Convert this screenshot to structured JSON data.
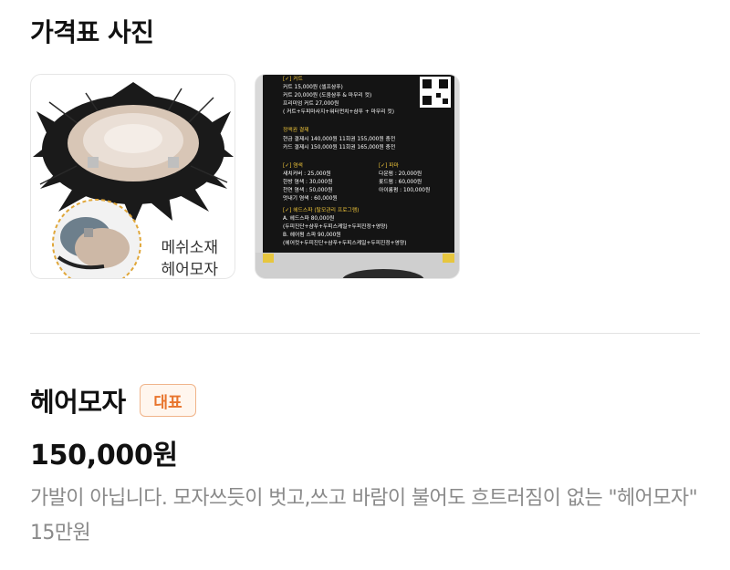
{
  "section": {
    "title": "가격표 사진"
  },
  "photos": [
    {
      "caption_line1": "메쉬소재",
      "caption_line2": "헤어모자"
    },
    {
      "board": {
        "lines_top": [
          "[✓] 커트",
          "커트 15,000원 (셀프샴푸)",
          "커트 20,000원 (도움샴푸 & 마무리 컷)",
          "프리미엄 커트 27,000원",
          "( 커트+두피마사지+워터펀치+샴푸 + 마무리 컷)"
        ],
        "prepaid_title": "정액권 결제",
        "prepaid_lines": [
          "현금 결제시 140,000원 11회권 155,000원 충전",
          "카드 결제시 150,000원 11회권 165,000원 충전"
        ],
        "dye_title": "[✓] 염색",
        "dye_lines": [
          "새치커버 : 25,000원",
          "한방 염색 : 30,000원",
          "천연 염색 : 50,000원",
          "멋내기 염색 : 60,000원"
        ],
        "perm_title": "[✓] 파마",
        "perm_lines": [
          "다운펌 : 20,000원",
          "롯드펌 : 60,000원",
          "아이롱펌 : 100,000원"
        ],
        "spa_title": "[✓] 헤드스파 (탈모관리 프로그램)",
        "spa_lines": [
          "A. 헤드스파 80,000원",
          "(두피진단+샴푸+두피스케일+두피진정+영양)",
          "B. 헤어펌 스파 90,000원",
          "(헤어컷+두피진단+샴푸+두피스케일+두피진정+영양)"
        ]
      }
    }
  ],
  "product": {
    "name": "헤어모자",
    "badge": "대표",
    "price": "150,000원",
    "description": "가발이 아닙니다. 모자쓰듯이 벗고,쓰고 바람이 불어도 흐트러짐이 없는 \"헤어모자\" 15만원"
  }
}
